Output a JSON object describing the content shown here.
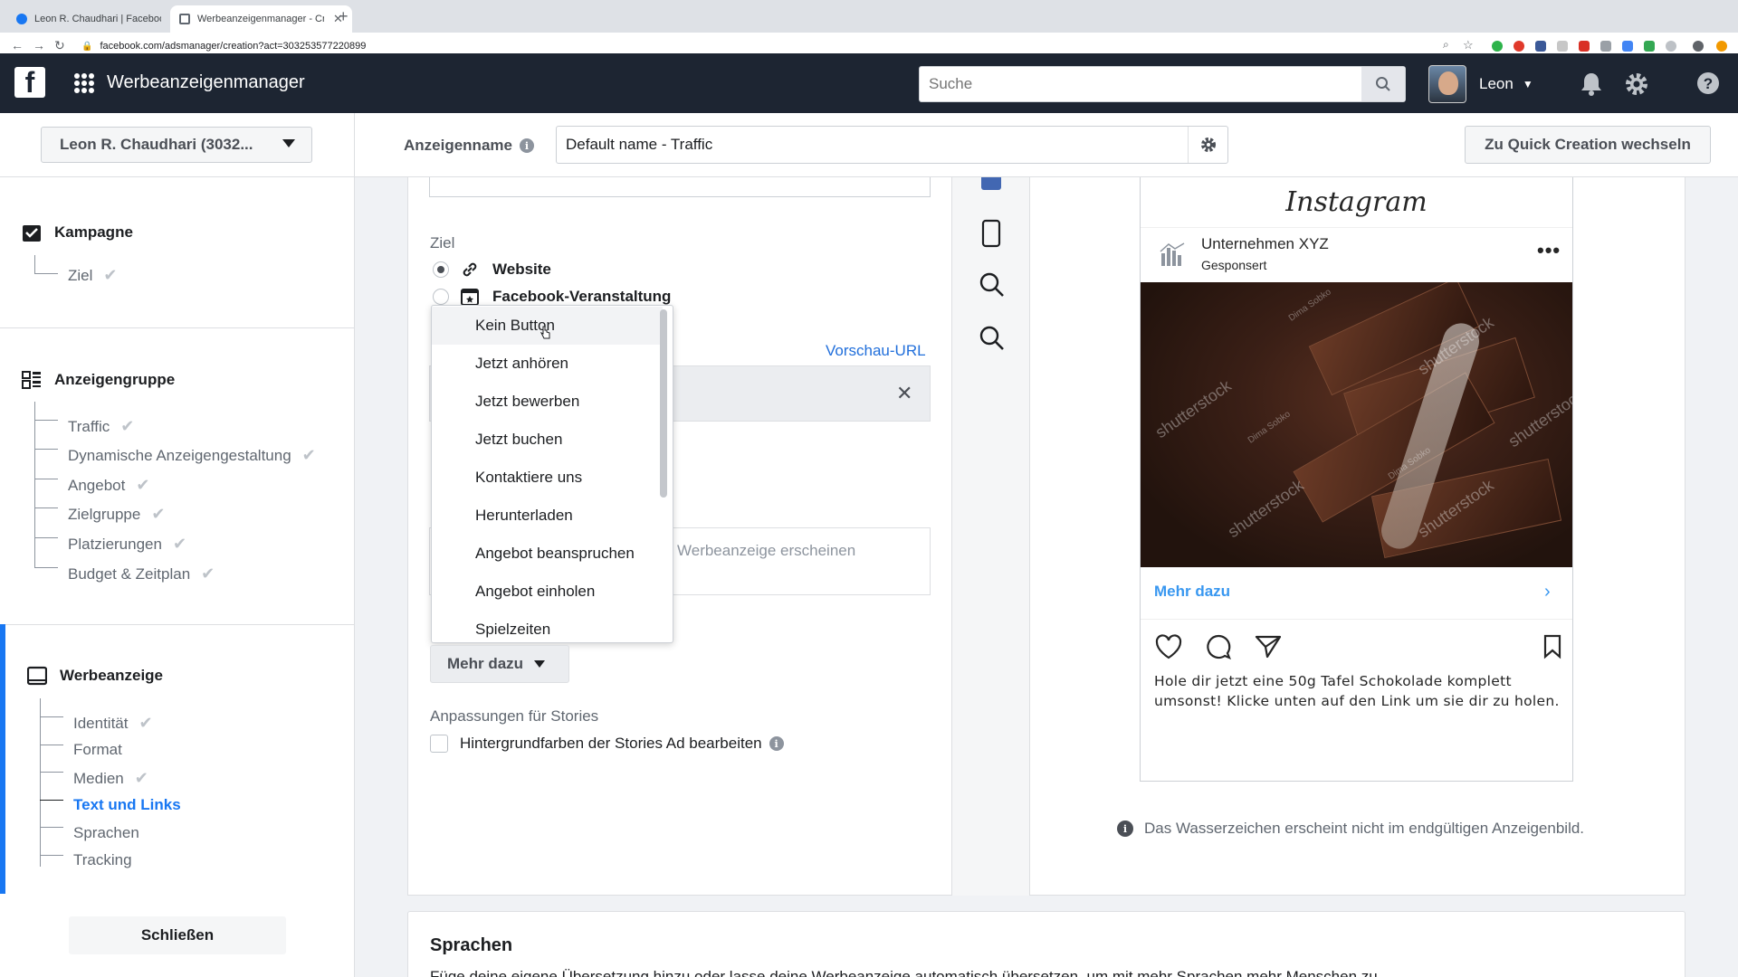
{
  "browser": {
    "tabs": [
      {
        "title": "Leon R. Chaudhari | Facebook",
        "active": false
      },
      {
        "title": "Werbeanzeigenmanager - Creat",
        "active": true
      }
    ],
    "url": "facebook.com/adsmanager/creation?act=303253577220899"
  },
  "topbar": {
    "logo": "f",
    "app_title": "Werbeanzeigenmanager",
    "search_placeholder": "Suche",
    "user_name": "Leon"
  },
  "header": {
    "account_selector": "Leon R. Chaudhari (3032...",
    "ad_name_label": "Anzeigenname",
    "ad_name_value": "Default name - Traffic",
    "quick_creation_button": "Zu Quick Creation wechseln"
  },
  "sidebar": {
    "sections": [
      {
        "title": "Kampagne",
        "items": [
          {
            "label": "Ziel",
            "done": true
          }
        ]
      },
      {
        "title": "Anzeigengruppe",
        "items": [
          {
            "label": "Traffic",
            "done": true
          },
          {
            "label": "Dynamische Anzeigengestaltung",
            "done": true
          },
          {
            "label": "Angebot",
            "done": true
          },
          {
            "label": "Zielgruppe",
            "done": true
          },
          {
            "label": "Platzierungen",
            "done": true
          },
          {
            "label": "Budget & Zeitplan",
            "done": true
          }
        ]
      },
      {
        "title": "Werbeanzeige",
        "items": [
          {
            "label": "Identität",
            "done": true
          },
          {
            "label": "Format",
            "done": false
          },
          {
            "label": "Medien",
            "done": true
          },
          {
            "label": "Text und Links",
            "done": false,
            "active": true
          },
          {
            "label": "Sprachen",
            "done": false
          },
          {
            "label": "Tracking",
            "done": false
          }
        ]
      }
    ],
    "close_button": "Schließen"
  },
  "editor": {
    "destination_label": "Ziel",
    "destination_options": [
      {
        "label": "Website",
        "selected": true
      },
      {
        "label": "Facebook-Veranstaltung",
        "selected": false
      }
    ],
    "preview_url_link": "Vorschau-URL",
    "text_placeholder_fragment": "Werbeanzeige erscheinen",
    "cta_dropdown_options": [
      "Kein Button",
      "Jetzt anhören",
      "Jetzt bewerben",
      "Jetzt buchen",
      "Kontaktiere uns",
      "Herunterladen",
      "Angebot beanspruchen",
      "Angebot einholen",
      "Spielzeiten"
    ],
    "cta_selected": "Mehr dazu",
    "stories_label": "Anpassungen für Stories",
    "stories_checkbox_label": "Hintergrundfarben der Stories Ad bearbeiten",
    "stories_checkbox_checked": false
  },
  "preview": {
    "platform": "Instagram",
    "page_name": "Unternehmen XYZ",
    "sponsored": "Gesponsert",
    "cta_label": "Mehr dazu",
    "caption": "Hole dir jetzt eine 50g Tafel Schokolade komplett umsonst! Klicke unten auf den Link um sie dir zu holen.",
    "image_watermark": "shutterstock",
    "image_credit": "Dima Sobko",
    "watermark_note": "Das Wasserzeichen erscheint nicht im endgültigen Anzeigenbild."
  },
  "languages": {
    "title": "Sprachen",
    "description": "Füge deine eigene Übersetzung hinzu oder lasse deine Werbeanzeige automatisch übersetzen, um mit mehr Sprachen mehr Menschen zu"
  },
  "colors": {
    "fb_blue": "#1877f2",
    "topbar": "#1d2532",
    "link_blue": "#216fdb",
    "ig_blue": "#3897f0"
  }
}
